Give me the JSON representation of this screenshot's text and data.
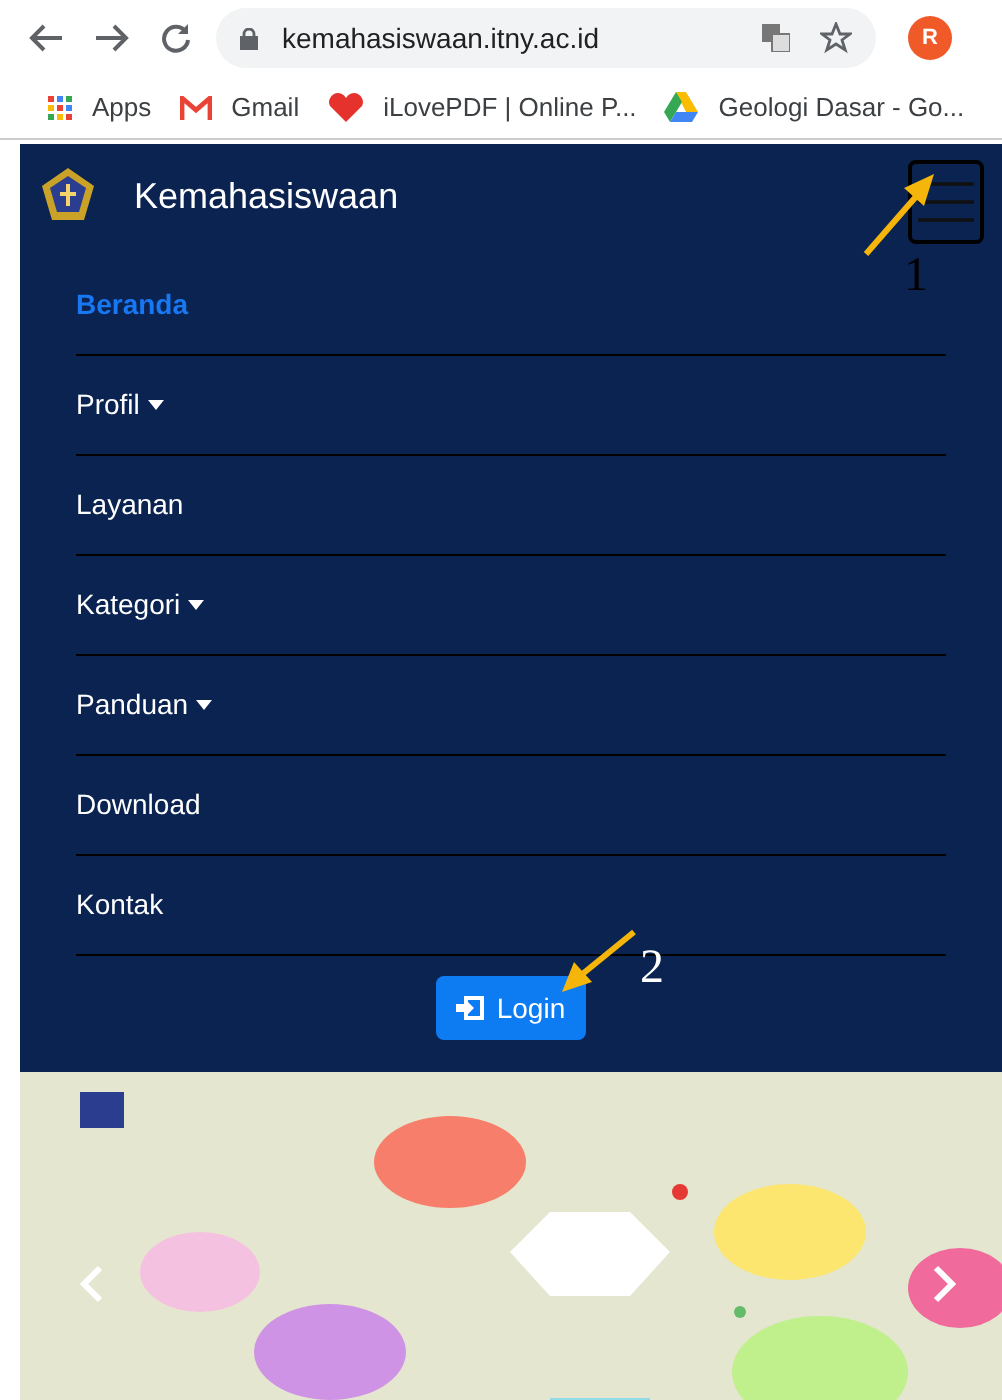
{
  "browser": {
    "url": "kemahasiswaan.itny.ac.id",
    "profile_initial": "R"
  },
  "bookmarks": [
    {
      "label": "Apps",
      "kind": "apps"
    },
    {
      "label": "Gmail",
      "kind": "mail"
    },
    {
      "label": "iLovePDF | Online P...",
      "kind": "heart"
    },
    {
      "label": "Geologi Dasar - Go...",
      "kind": "drive"
    }
  ],
  "navbar": {
    "brand": "Kemahasiswaan",
    "menu_expanded": true
  },
  "menu": [
    {
      "label": "Beranda",
      "selected": true,
      "dropdown": false
    },
    {
      "label": "Profil",
      "selected": false,
      "dropdown": true
    },
    {
      "label": "Layanan",
      "selected": false,
      "dropdown": false
    },
    {
      "label": "Kategori",
      "selected": false,
      "dropdown": true
    },
    {
      "label": "Panduan",
      "selected": false,
      "dropdown": true
    },
    {
      "label": "Download",
      "selected": false,
      "dropdown": false
    },
    {
      "label": "Kontak",
      "selected": false,
      "dropdown": false
    }
  ],
  "login_button": "Login",
  "annotations": [
    "1",
    "2"
  ]
}
